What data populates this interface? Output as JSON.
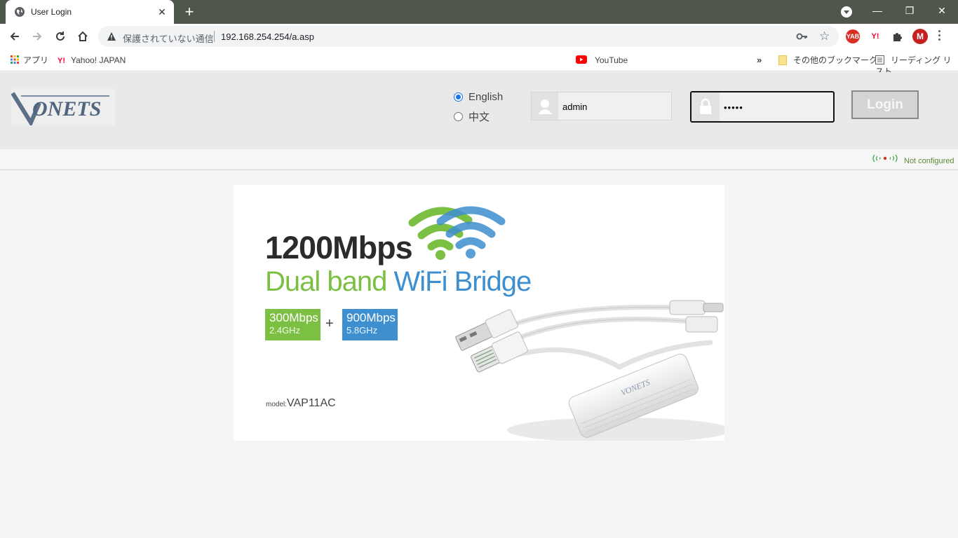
{
  "browser": {
    "tab": {
      "title": "User Login",
      "close": "✕",
      "favicon": "globe-icon"
    },
    "new_tab": "+",
    "window_controls": {
      "minimize": "—",
      "restore": "❐",
      "close": "✕"
    },
    "omnibox": {
      "security_text": "保護されていない通信",
      "url": "192.168.254.254/a.asp"
    },
    "extensions": [
      {
        "name": "yab-extension-icon",
        "label": "YAB",
        "color": "#d93025"
      },
      {
        "name": "yahoo-extension-icon",
        "label": "Y!",
        "color": "#ff0033"
      },
      {
        "name": "profile-avatar",
        "label": "M",
        "color": "#c5221f"
      }
    ],
    "bookmarks": {
      "apps": "アプリ",
      "yahoo": "Yahoo! JAPAN",
      "youtube": "YouTube",
      "more": "»",
      "other": "その他のブックマーク",
      "reading_list": "リーディング リスト"
    }
  },
  "login": {
    "languages": [
      {
        "label": "English",
        "selected": true
      },
      {
        "label": "中文",
        "selected": false
      }
    ],
    "username": "admin",
    "password_masked": "•••••",
    "login_button": "Login"
  },
  "status": {
    "text": "Not configured"
  },
  "banner": {
    "speed": "1200Mbps",
    "subtitle_green": "Dual band",
    "subtitle_blue": "WiFi Bridge",
    "band1": {
      "speed": "300Mbps",
      "freq": "2.4GHz",
      "color": "#7bbf43"
    },
    "plus": "+",
    "band2": {
      "speed": "900Mbps",
      "freq": "5.8GHz",
      "color": "#3d8fd0"
    },
    "model_label": "model:",
    "model_value": "VAP11AC"
  },
  "colors": {
    "tabbar": "#4f574c",
    "header": "#e9e9e9",
    "accent_green": "#7bbf43",
    "accent_blue": "#3d8fd0"
  }
}
